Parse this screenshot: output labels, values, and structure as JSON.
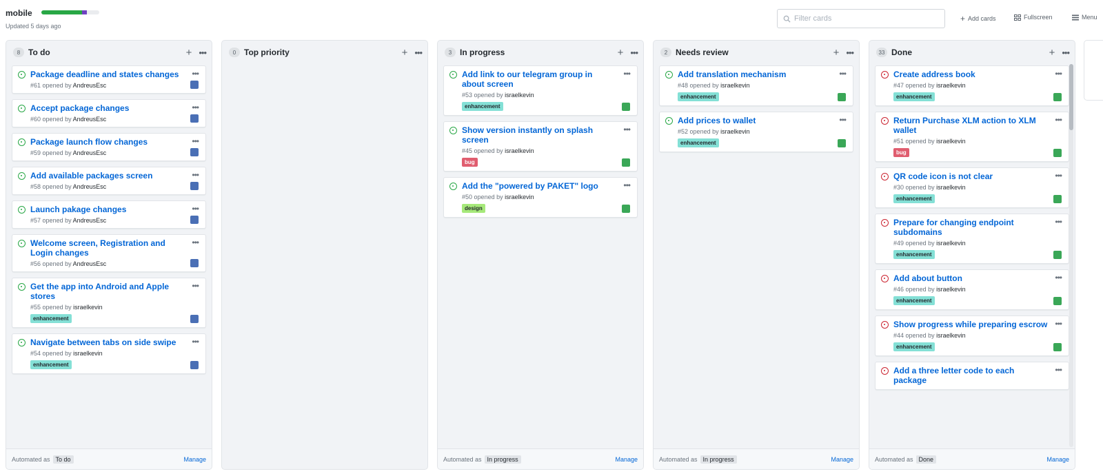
{
  "project": {
    "title": "mobile",
    "updated": "Updated 5 days ago",
    "progress": {
      "done_fraction": 0.7,
      "in_progress_fraction": 0.09,
      "todo_fraction": 0.21
    }
  },
  "colors": {
    "done": "#28a745",
    "in_progress": "#6f42c1",
    "open_icon": "#28a745",
    "closed_icon": "#cb2431",
    "link": "#0366d6",
    "label_enhancement": "#84e0d6",
    "label_bug": "#e05d6f",
    "label_design": "#a6e97a"
  },
  "header": {
    "filter_placeholder": "Filter cards",
    "add_cards": "Add cards",
    "fullscreen": "Fullscreen",
    "menu": "Menu"
  },
  "columns": [
    {
      "name": "To do",
      "count": "8",
      "automation_label": "Automated as",
      "automation_value": "To do",
      "manage": "Manage",
      "cards": [
        {
          "title": "Package deadline and states changes",
          "number": "#61",
          "opened_by": "opened by",
          "author": "AndreusEsc",
          "label": "",
          "state": "open",
          "avatar": "blue"
        },
        {
          "title": "Accept package changes",
          "number": "#60",
          "opened_by": "opened by",
          "author": "AndreusEsc",
          "label": "",
          "state": "open",
          "avatar": "blue"
        },
        {
          "title": "Package launch flow changes",
          "number": "#59",
          "opened_by": "opened by",
          "author": "AndreusEsc",
          "label": "",
          "state": "open",
          "avatar": "blue"
        },
        {
          "title": "Add available packages screen",
          "number": "#58",
          "opened_by": "opened by",
          "author": "AndreusEsc",
          "label": "",
          "state": "open",
          "avatar": "blue"
        },
        {
          "title": "Launch pakage changes",
          "number": "#57",
          "opened_by": "opened by",
          "author": "AndreusEsc",
          "label": "",
          "state": "open",
          "avatar": "blue"
        },
        {
          "title": "Welcome screen, Registration and Login changes",
          "number": "#56",
          "opened_by": "opened by",
          "author": "AndreusEsc",
          "label": "",
          "state": "open",
          "avatar": "blue"
        },
        {
          "title": "Get the app into Android and Apple stores",
          "number": "#55",
          "opened_by": "opened by",
          "author": "israelkevin",
          "label": "enhancement",
          "state": "open",
          "avatar": "blue"
        },
        {
          "title": "Navigate between tabs on side swipe",
          "number": "#54",
          "opened_by": "opened by",
          "author": "israelkevin",
          "label": "enhancement",
          "state": "open",
          "avatar": "blue"
        }
      ]
    },
    {
      "name": "Top priority",
      "count": "0",
      "automation_label": "",
      "automation_value": "",
      "manage": "",
      "cards": []
    },
    {
      "name": "In progress",
      "count": "3",
      "automation_label": "Automated as",
      "automation_value": "In progress",
      "manage": "Manage",
      "cards": [
        {
          "title": "Add link to our telegram group in about screen",
          "number": "#53",
          "opened_by": "opened by",
          "author": "israelkevin",
          "label": "enhancement",
          "state": "open",
          "avatar": "green"
        },
        {
          "title": "Show version instantly on splash screen",
          "number": "#45",
          "opened_by": "opened by",
          "author": "israelkevin",
          "label": "bug",
          "state": "open",
          "avatar": "green"
        },
        {
          "title": "Add the \"powered by PAKET\" logo",
          "number": "#50",
          "opened_by": "opened by",
          "author": "israelkevin",
          "label": "design",
          "state": "open",
          "avatar": "green"
        }
      ]
    },
    {
      "name": "Needs review",
      "count": "2",
      "automation_label": "Automated as",
      "automation_value": "In progress",
      "manage": "Manage",
      "cards": [
        {
          "title": "Add translation mechanism",
          "number": "#48",
          "opened_by": "opened by",
          "author": "israelkevin",
          "label": "enhancement",
          "state": "open",
          "avatar": "green"
        },
        {
          "title": "Add prices to wallet",
          "number": "#52",
          "opened_by": "opened by",
          "author": "israelkevin",
          "label": "enhancement",
          "state": "open",
          "avatar": "green"
        }
      ]
    },
    {
      "name": "Done",
      "count": "33",
      "automation_label": "Automated as",
      "automation_value": "Done",
      "manage": "Manage",
      "cards": [
        {
          "title": "Create address book",
          "number": "#47",
          "opened_by": "opened by",
          "author": "israelkevin",
          "label": "enhancement",
          "state": "closed",
          "avatar": "green"
        },
        {
          "title": "Return Purchase XLM action to XLM wallet",
          "number": "#51",
          "opened_by": "opened by",
          "author": "israelkevin",
          "label": "bug",
          "state": "closed",
          "avatar": "green"
        },
        {
          "title": "QR code icon is not clear",
          "number": "#30",
          "opened_by": "opened by",
          "author": "israelkevin",
          "label": "enhancement",
          "state": "closed",
          "avatar": "green"
        },
        {
          "title": "Prepare for changing endpoint subdomains",
          "number": "#49",
          "opened_by": "opened by",
          "author": "israelkevin",
          "label": "enhancement",
          "state": "closed",
          "avatar": "green"
        },
        {
          "title": "Add about button",
          "number": "#46",
          "opened_by": "opened by",
          "author": "israelkevin",
          "label": "enhancement",
          "state": "closed",
          "avatar": "green"
        },
        {
          "title": "Show progress while preparing escrow",
          "number": "#44",
          "opened_by": "opened by",
          "author": "israelkevin",
          "label": "enhancement",
          "state": "closed",
          "avatar": "green"
        },
        {
          "title": "Add a three letter code to each package",
          "number": "",
          "opened_by": "",
          "author": "",
          "label": "",
          "state": "closed",
          "avatar": ""
        }
      ]
    }
  ]
}
